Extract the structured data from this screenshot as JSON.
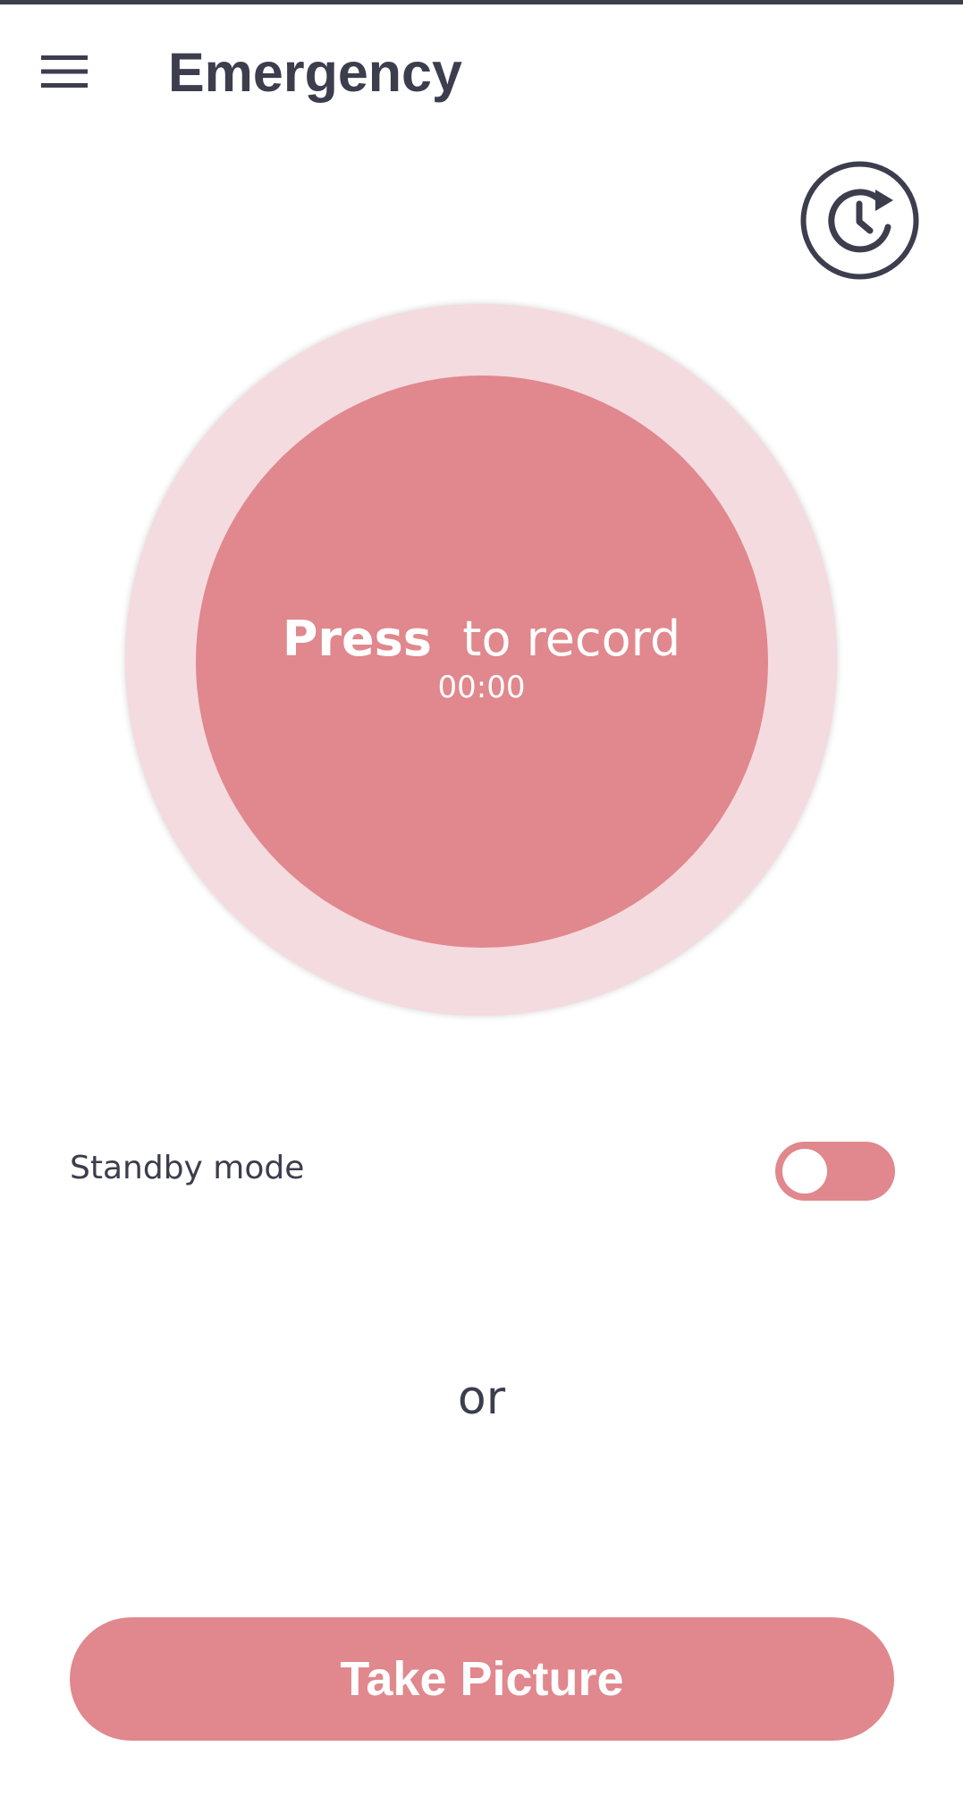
{
  "header": {
    "title": "Emergency",
    "menu_icon": "hamburger-menu-icon",
    "history_icon": "clock-history-icon"
  },
  "recorder": {
    "press_word": "Press",
    "prompt_rest": "to record",
    "timer": "00:00"
  },
  "standby": {
    "label": "Standby mode",
    "enabled": false
  },
  "divider_text": "or",
  "take_picture": {
    "label": "Take Picture"
  },
  "colors": {
    "accent": "#e0888d",
    "accent_light": "#f4dbdf",
    "text_dark": "#3c3d4d",
    "background": "#ffffff"
  }
}
